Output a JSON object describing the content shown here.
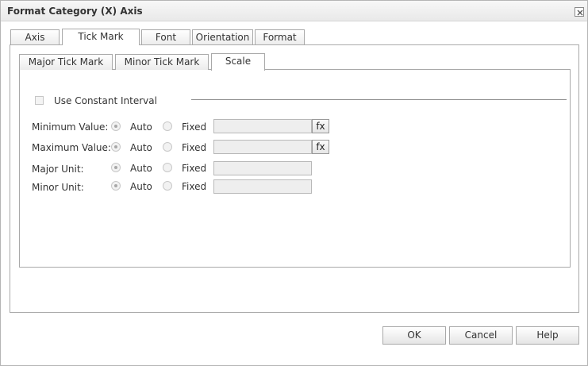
{
  "dialog": {
    "title": "Format Category (X) Axis"
  },
  "tabs": [
    "Axis",
    "Tick Mark",
    "Font",
    "Orientation",
    "Format"
  ],
  "active_tab": "Tick Mark",
  "subtabs": [
    "Major Tick Mark",
    "Minor Tick Mark",
    "Scale"
  ],
  "active_subtab": "Scale",
  "scale": {
    "constant_interval_label": "Use Constant Interval",
    "constant_interval_checked": false,
    "rows": [
      {
        "label": "Minimum Value:",
        "auto": "Auto",
        "fixed": "Fixed",
        "value": "",
        "fx": "fx"
      },
      {
        "label": "Maximum Value:",
        "auto": "Auto",
        "fixed": "Fixed",
        "value": "",
        "fx": "fx"
      },
      {
        "label": "Major Unit:",
        "auto": "Auto",
        "fixed": "Fixed",
        "value": ""
      },
      {
        "label": "Minor Unit:",
        "auto": "Auto",
        "fixed": "Fixed",
        "value": ""
      }
    ]
  },
  "buttons": {
    "ok": "OK",
    "cancel": "Cancel",
    "help": "Help"
  }
}
